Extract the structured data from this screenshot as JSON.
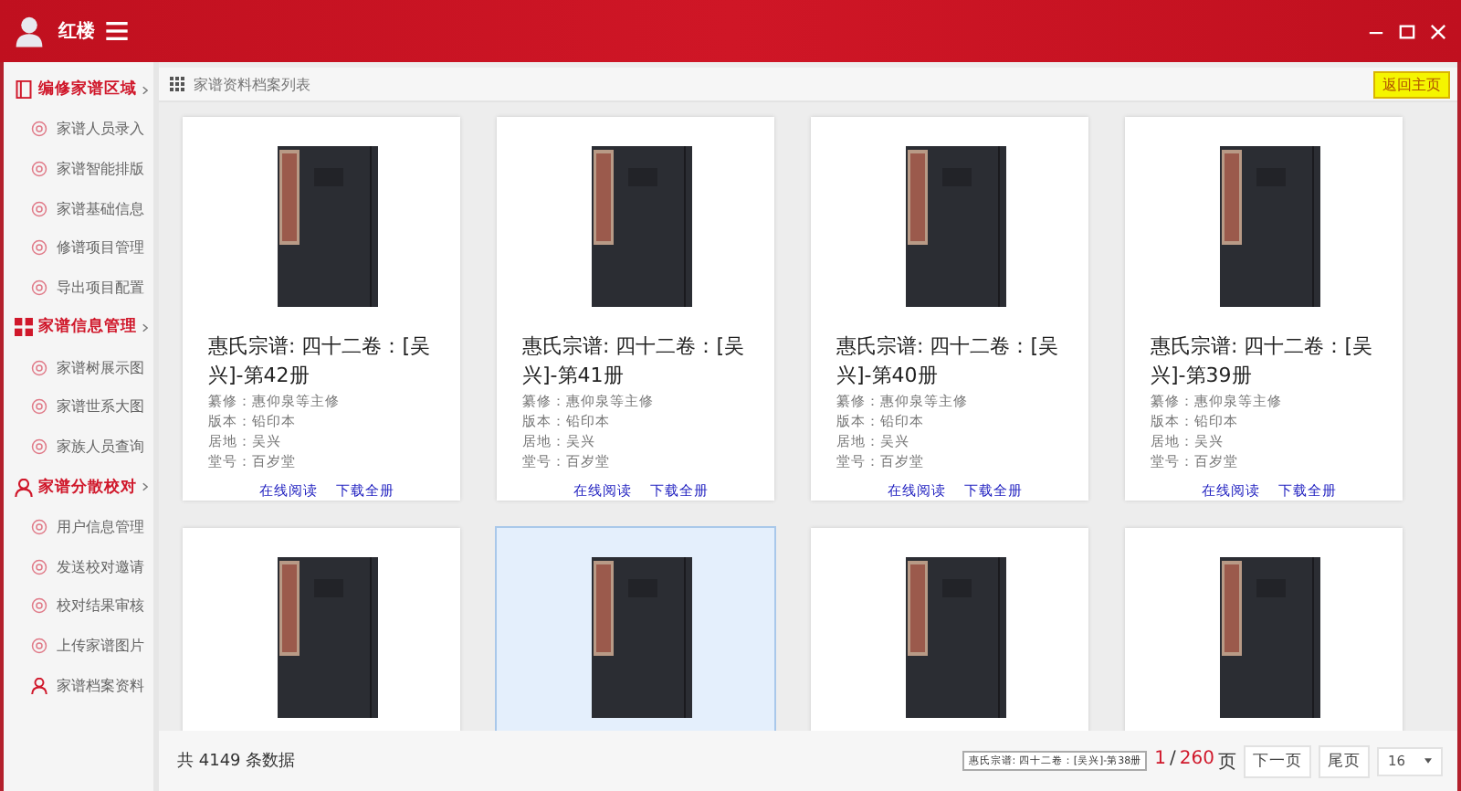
{
  "header": {
    "title": "红楼"
  },
  "sidebar": {
    "sections": [
      {
        "label": "编修家谱区域",
        "kind": "book",
        "children": [
          {
            "label": "家谱人员录入",
            "kind": "circle"
          },
          {
            "label": "家谱智能排版",
            "kind": "circle"
          },
          {
            "label": "家谱基础信息",
            "kind": "circle"
          },
          {
            "label": "修谱项目管理",
            "kind": "circle"
          },
          {
            "label": "导出项目配置",
            "kind": "circle"
          }
        ]
      },
      {
        "label": "家谱信息管理",
        "kind": "grid",
        "children": [
          {
            "label": "家谱树展示图",
            "kind": "circle"
          },
          {
            "label": "家谱世系大图",
            "kind": "circle"
          },
          {
            "label": "家族人员查询",
            "kind": "circle"
          }
        ]
      },
      {
        "label": "家谱分散校对",
        "kind": "person",
        "children": [
          {
            "label": "用户信息管理",
            "kind": "circle"
          },
          {
            "label": "发送校对邀请",
            "kind": "circle"
          },
          {
            "label": "校对结果审核",
            "kind": "circle"
          },
          {
            "label": "上传家谱图片",
            "kind": "circle"
          },
          {
            "label": "家谱档案资料",
            "kind": "person"
          }
        ]
      }
    ]
  },
  "breadcrumb": "家谱资料档案列表",
  "home_button": "返回主页",
  "cards": [
    {
      "title": "惠氏宗谱: 四十二卷：[吴兴]-第42册",
      "fields": [
        "纂修：惠仰泉等主修",
        "版本：铅印本",
        "居地：吴兴",
        "堂号：百岁堂"
      ],
      "links": [
        "在线阅读",
        "下载全册"
      ],
      "selected": false
    },
    {
      "title": "惠氏宗谱: 四十二卷：[吴兴]-第41册",
      "fields": [
        "纂修：惠仰泉等主修",
        "版本：铅印本",
        "居地：吴兴",
        "堂号：百岁堂"
      ],
      "links": [
        "在线阅读",
        "下载全册"
      ],
      "selected": false
    },
    {
      "title": "惠氏宗谱: 四十二卷：[吴兴]-第40册",
      "fields": [
        "纂修：惠仰泉等主修",
        "版本：铅印本",
        "居地：吴兴",
        "堂号：百岁堂"
      ],
      "links": [
        "在线阅读",
        "下载全册"
      ],
      "selected": false
    },
    {
      "title": "惠氏宗谱: 四十二卷：[吴兴]-第39册",
      "fields": [
        "纂修：惠仰泉等主修",
        "版本：铅印本",
        "居地：吴兴",
        "堂号：百岁堂"
      ],
      "links": [
        "在线阅读",
        "下载全册"
      ],
      "selected": false
    },
    {
      "selected": false
    },
    {
      "selected": true
    },
    {
      "selected": false
    },
    {
      "selected": false
    }
  ],
  "footer": {
    "total": "共 4149 条数据",
    "current_title": "惠氏宗谱: 四十二卷：[吴兴]-第38册",
    "page": "1",
    "separator": "/",
    "pages": "260",
    "page_unit": "页",
    "next_button": "下一页",
    "last_button": "尾页",
    "page_size": "16"
  }
}
